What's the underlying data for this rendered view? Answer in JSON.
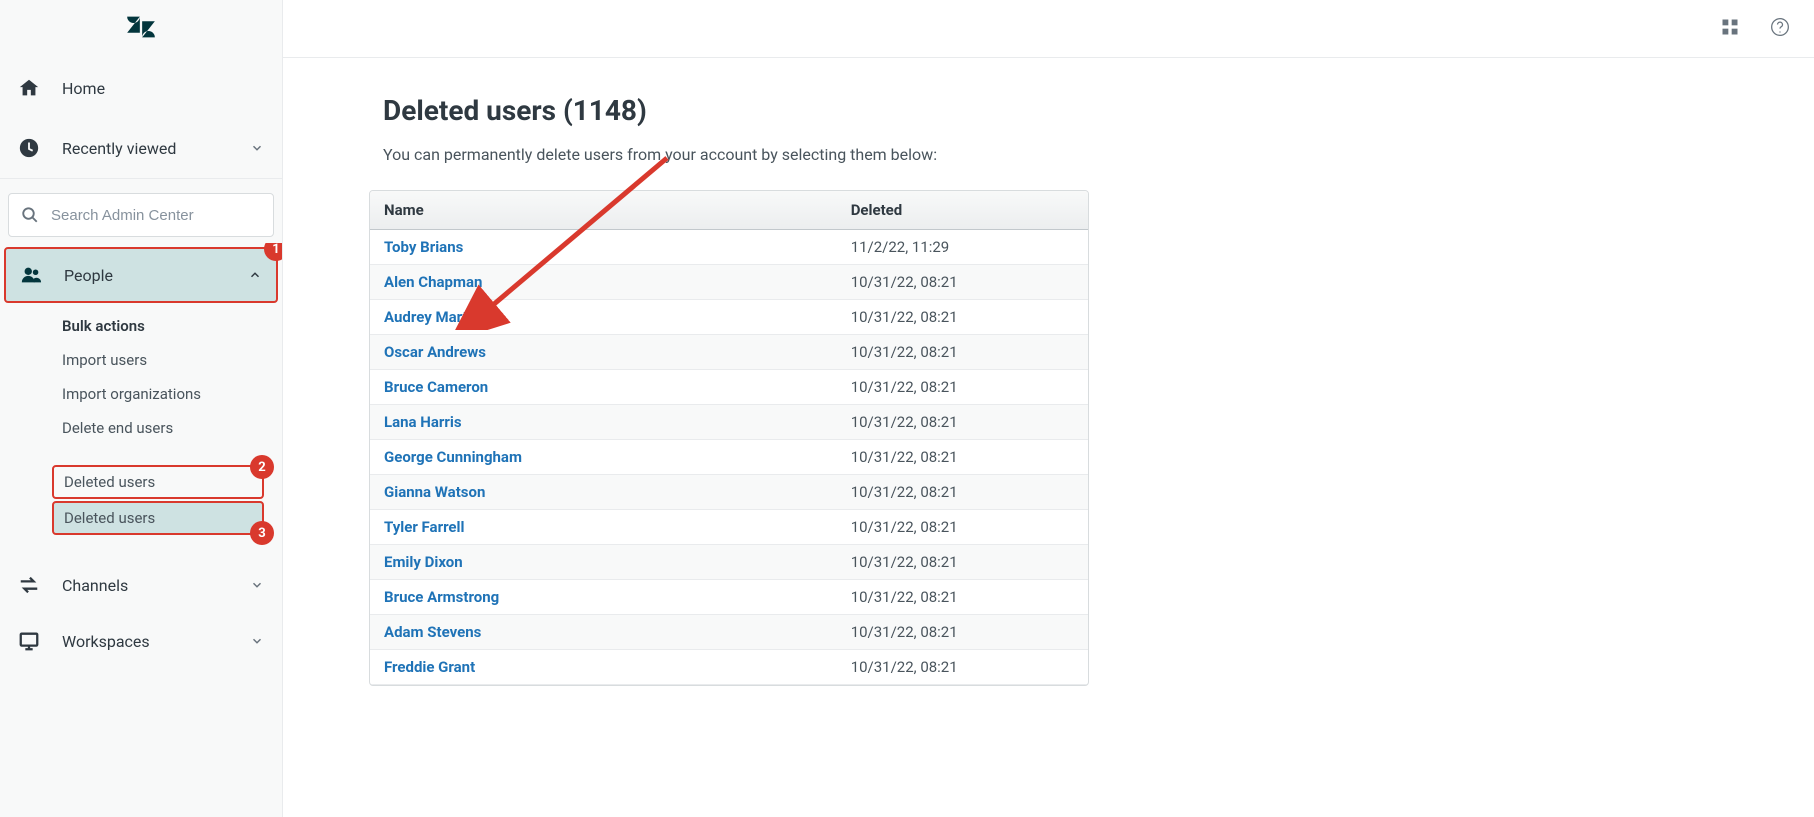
{
  "sidebar": {
    "home": "Home",
    "recent": "Recently viewed",
    "search_placeholder": "Search Admin Center",
    "sections": {
      "people": {
        "label": "People",
        "groups": [
          {
            "title": "Bulk actions",
            "items": [
              "Import users",
              "Import organizations",
              "Delete end users"
            ]
          }
        ],
        "deleted1": "Deleted users",
        "deleted2": "Deleted users"
      },
      "channels": "Channels",
      "workspaces": "Workspaces"
    }
  },
  "page": {
    "title": "Deleted users (1148)",
    "subtitle": "You can permanently delete users from your account by selecting them below:"
  },
  "table": {
    "columns": {
      "name": "Name",
      "deleted": "Deleted"
    },
    "rows": [
      {
        "name": "Toby Brians",
        "deleted": "11/2/22, 11:29"
      },
      {
        "name": "Alen Chapman",
        "deleted": "10/31/22, 08:21"
      },
      {
        "name": "Audrey Martin",
        "deleted": "10/31/22, 08:21"
      },
      {
        "name": "Oscar Andrews",
        "deleted": "10/31/22, 08:21"
      },
      {
        "name": "Bruce Cameron",
        "deleted": "10/31/22, 08:21"
      },
      {
        "name": "Lana Harris",
        "deleted": "10/31/22, 08:21"
      },
      {
        "name": "George Cunningham",
        "deleted": "10/31/22, 08:21"
      },
      {
        "name": "Gianna Watson",
        "deleted": "10/31/22, 08:21"
      },
      {
        "name": "Tyler Farrell",
        "deleted": "10/31/22, 08:21"
      },
      {
        "name": "Emily Dixon",
        "deleted": "10/31/22, 08:21"
      },
      {
        "name": "Bruce Armstrong",
        "deleted": "10/31/22, 08:21"
      },
      {
        "name": "Adam Stevens",
        "deleted": "10/31/22, 08:21"
      },
      {
        "name": "Freddie Grant",
        "deleted": "10/31/22, 08:21"
      }
    ]
  },
  "annotations": {
    "badge1": "1",
    "badge2": "2",
    "badge3": "3"
  }
}
